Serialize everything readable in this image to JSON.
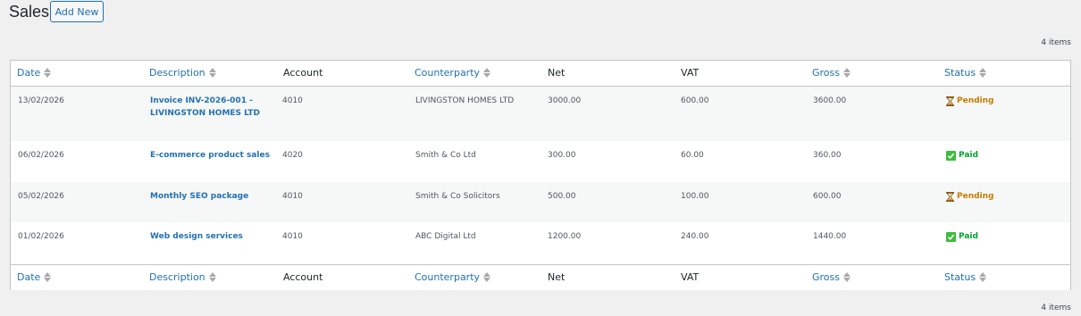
{
  "header": {
    "title": "Sales",
    "add_new_label": "Add New"
  },
  "item_count": "4 items",
  "columns": [
    {
      "label": "Date",
      "sortable": true
    },
    {
      "label": "Description",
      "sortable": true
    },
    {
      "label": "Account",
      "sortable": false
    },
    {
      "label": "Counterparty",
      "sortable": true
    },
    {
      "label": "Net",
      "sortable": false
    },
    {
      "label": "VAT",
      "sortable": false
    },
    {
      "label": "Gross",
      "sortable": true
    },
    {
      "label": "Status",
      "sortable": true
    }
  ],
  "rows": [
    {
      "date": "13/02/2026",
      "description": "Invoice INV-2026-001 - LIVINGSTON HOMES LTD",
      "account": "4010",
      "counterparty": "LIVINGSTON HOMES LTD",
      "net": "3000.00",
      "vat": "600.00",
      "gross": "3600.00",
      "status": "Pending",
      "status_icon": "hourglass-icon"
    },
    {
      "date": "06/02/2026",
      "description": "E-commerce product sales",
      "account": "4020",
      "counterparty": "Smith & Co Ltd",
      "net": "300.00",
      "vat": "60.00",
      "gross": "360.00",
      "status": "Paid",
      "status_icon": "check-icon"
    },
    {
      "date": "05/02/2026",
      "description": "Monthly SEO package",
      "account": "4010",
      "counterparty": "Smith & Co Solicitors",
      "net": "500.00",
      "vat": "100.00",
      "gross": "600.00",
      "status": "Pending",
      "status_icon": "hourglass-icon"
    },
    {
      "date": "01/02/2026",
      "description": "Web design services",
      "account": "4010",
      "counterparty": "ABC Digital Ltd",
      "net": "1200.00",
      "vat": "240.00",
      "gross": "1440.00",
      "status": "Paid",
      "status_icon": "check-icon"
    }
  ],
  "colors": {
    "link": "#2271b1",
    "pending": "#c77c02",
    "paid": "#00a32a",
    "background": "#f0f0f1"
  }
}
